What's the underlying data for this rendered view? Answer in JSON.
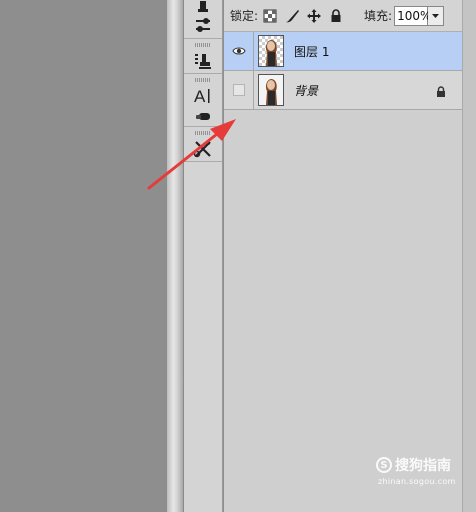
{
  "lock_bar": {
    "lock_label": "锁定:",
    "lock_icons": [
      "lock-transparent-pixels-icon",
      "lock-image-pixels-icon",
      "lock-position-icon",
      "lock-all-icon"
    ],
    "fill_label": "填充:",
    "fill_value": "100%"
  },
  "tools": [
    "stamp-icon",
    "adjustments-icon",
    "clone-source-icon",
    "character-text-icon",
    "eraser-icon",
    "tool-presets-icon"
  ],
  "layers": [
    {
      "name": "图层 1",
      "visible": true,
      "selected": true,
      "locked": false,
      "transparent": true
    },
    {
      "name": "背景",
      "visible": false,
      "selected": false,
      "locked": true,
      "transparent": false
    }
  ],
  "watermark": {
    "title": "搜狗指南",
    "url": "zhinan.sogou.com",
    "logo": "S"
  },
  "colors": {
    "arrow": "#e53b3b",
    "selection": "#b8cff5"
  }
}
